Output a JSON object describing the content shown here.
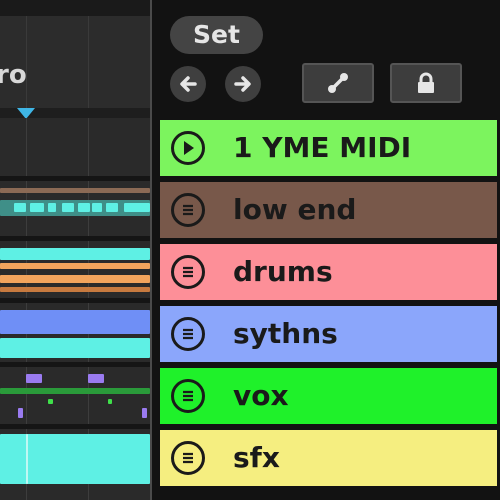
{
  "arrangement": {
    "locator_label": "ro"
  },
  "header": {
    "set_button_label": "Set",
    "nav_back_icon": "arrow-left-icon",
    "nav_forward_icon": "arrow-right-icon",
    "link_icon": "link-icon",
    "lock_icon": "lock-icon"
  },
  "tracks": [
    {
      "name": "1 YME MIDI",
      "color": "#7cf45e",
      "icon": "play-icon"
    },
    {
      "name": "low end",
      "color": "#78584a",
      "icon": "menu-icon"
    },
    {
      "name": "drums",
      "color": "#fd8f98",
      "icon": "menu-icon"
    },
    {
      "name": "sythns",
      "color": "#8ba6fb",
      "icon": "menu-icon"
    },
    {
      "name": "vox",
      "color": "#1ff12a",
      "icon": "menu-icon"
    },
    {
      "name": "sfx",
      "color": "#f5ee80",
      "icon": "menu-icon"
    }
  ],
  "colors": {
    "playhead": "#3fb6e6",
    "clip_cyan": "#5ef0e4",
    "clip_orange": "#f2a45c",
    "clip_purple": "#9a7bf0"
  }
}
